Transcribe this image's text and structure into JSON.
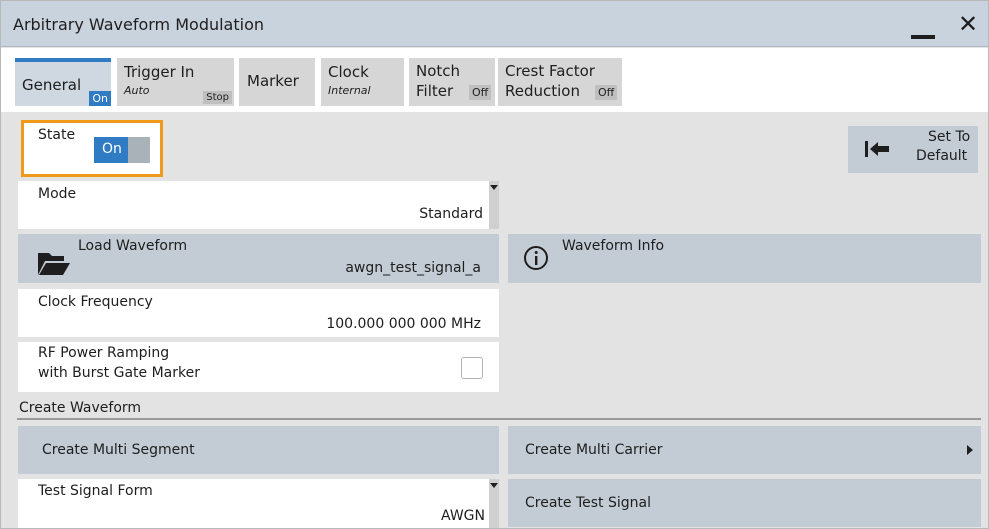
{
  "window": {
    "title": "Arbitrary Waveform Modulation",
    "minimize_icon": "minimize-icon",
    "close_icon": "close-icon",
    "close_glyph": "✕"
  },
  "tabs": [
    {
      "line1": "General",
      "badge": "On"
    },
    {
      "line1": "Trigger In",
      "line2": "Auto",
      "badge": "Stop"
    },
    {
      "line1": "Marker"
    },
    {
      "line1": "Clock",
      "line2": "Internal"
    },
    {
      "line1": "Notch",
      "line1b": "Filter",
      "badge": "Off"
    },
    {
      "line1": "Crest Factor",
      "line1b": "Reduction",
      "badge": "Off"
    }
  ],
  "state": {
    "label": "State",
    "value": "On"
  },
  "set_to_default": {
    "line1": "Set To",
    "line2": "Default",
    "icon": "arrow-to-left-bar-icon"
  },
  "mode": {
    "label": "Mode",
    "value": "Standard"
  },
  "load_waveform": {
    "label": "Load Waveform",
    "value": "awgn_test_signal_a",
    "icon": "folder-icon"
  },
  "waveform_info": {
    "label": "Waveform Info",
    "icon": "info-icon"
  },
  "clock_frequency": {
    "label": "Clock Frequency",
    "value": "100.000 000 000 MHz"
  },
  "rf_power_ramping": {
    "line1": "RF Power Ramping",
    "line2": "with Burst Gate Marker",
    "checked": false
  },
  "create_waveform": {
    "section_label": "Create Waveform",
    "multi_segment": "Create Multi Segment",
    "multi_carrier": "Create Multi Carrier",
    "test_signal_form_label": "Test Signal Form",
    "test_signal_form_value": "AWGN",
    "create_test_signal": "Create Test Signal"
  },
  "colors": {
    "accent": "#2f7cc4",
    "highlight_border": "#f09a1a",
    "title_bar": "#c9d3de",
    "button_gray": "#c3ccd5"
  }
}
